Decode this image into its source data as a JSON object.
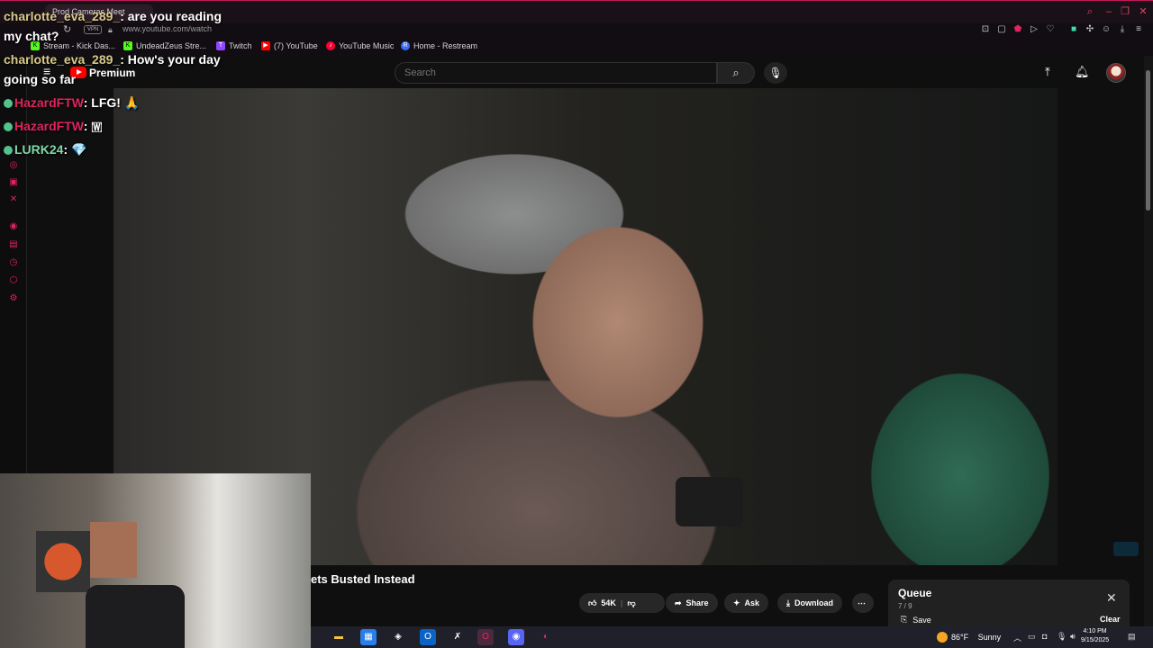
{
  "browser": {
    "tab_title": "Prod Cameras Meet",
    "url": "www.youtube.com/watch",
    "vpn_label": "VPN",
    "bookmarks": [
      {
        "label": "Stream - Kick Das...",
        "color": "#53fc18",
        "glyph": "K"
      },
      {
        "label": "UndeadZeus Stre...",
        "color": "#53fc18",
        "glyph": "K"
      },
      {
        "label": "Twitch",
        "color": "#9146ff",
        "glyph": "T"
      },
      {
        "label": "(7) YouTube",
        "color": "#ff0000",
        "glyph": "▶"
      },
      {
        "label": "YouTube Music",
        "color": "#ff0033",
        "glyph": "♪"
      },
      {
        "label": "Home - Restream",
        "color": "#3b6cf6",
        "glyph": "R"
      }
    ]
  },
  "youtube": {
    "logo_text": "Premium",
    "search_placeholder": "Search",
    "video_title_partial": "ets Busted Instead",
    "actions": {
      "like_count": "54K",
      "share": "Share",
      "ask": "Ask",
      "download": "Download"
    },
    "queue": {
      "title": "Queue",
      "count": "7 / 9",
      "save": "Save",
      "clear": "Clear"
    }
  },
  "chat": [
    {
      "user": "charlotte_eva_289_",
      "message": ": are you reading",
      "color": "u1"
    },
    {
      "user": "",
      "message": "my chat?",
      "color": "u1"
    },
    {
      "user": "charlotte_eva_289_",
      "message": ": How's your day",
      "color": "u1"
    },
    {
      "user": "",
      "message": "going so far",
      "color": "u1"
    },
    {
      "user": "HazardFTW",
      "message": ": LFG! 🙏",
      "color": "u2"
    },
    {
      "user": "HazardFTW",
      "message": ": 🇼",
      "color": "u2"
    },
    {
      "user": "LURK24",
      "message": ": 💎",
      "color": "u3"
    }
  ],
  "taskbar": {
    "weather_temp": "86°F",
    "weather_text": "Sunny",
    "time": "4:10 PM",
    "date": "9/15/2025"
  },
  "icons": {
    "search": "search-icon",
    "mic": "mic-icon",
    "bell": "bell-icon",
    "upload": "upload-icon",
    "close": "close-icon"
  }
}
